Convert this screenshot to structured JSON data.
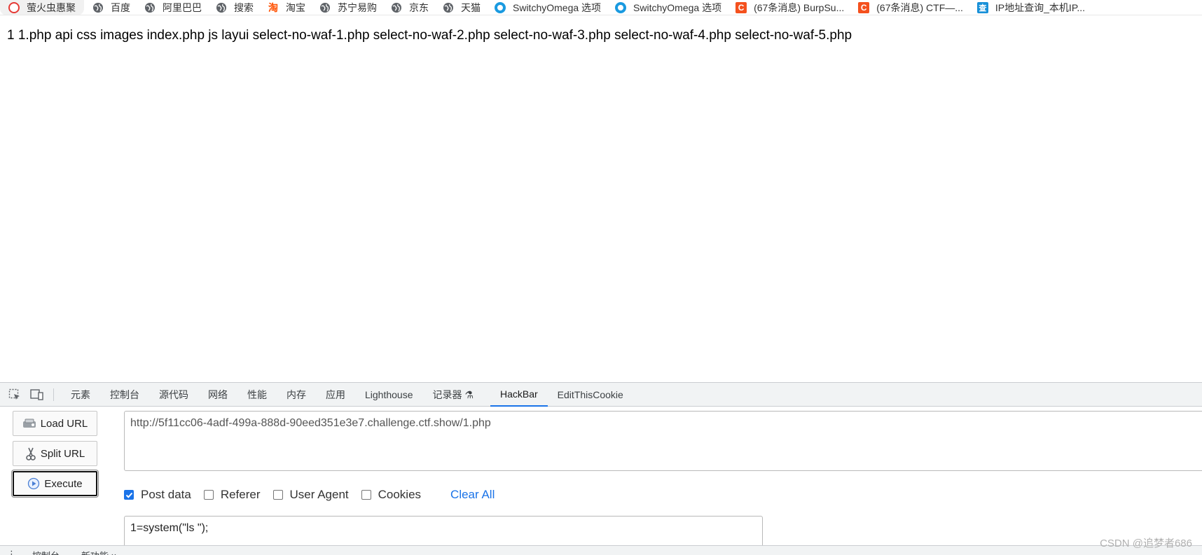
{
  "bookmarks": [
    {
      "label": "萤火虫惠聚",
      "icon": "ring-icon"
    },
    {
      "label": "百度",
      "icon": "globe-icon"
    },
    {
      "label": "阿里巴巴",
      "icon": "globe-icon"
    },
    {
      "label": "搜索",
      "icon": "globe-icon"
    },
    {
      "label": "淘宝",
      "icon": "taobao-icon",
      "glyph": "淘"
    },
    {
      "label": "苏宁易购",
      "icon": "globe-icon"
    },
    {
      "label": "京东",
      "icon": "globe-icon"
    },
    {
      "label": "天猫",
      "icon": "globe-icon"
    },
    {
      "label": "SwitchyOmega 选项",
      "icon": "switchyomega-icon"
    },
    {
      "label": "SwitchyOmega 选项",
      "icon": "switchyomega-icon"
    },
    {
      "label": "(67条消息) BurpSu...",
      "icon": "csdn-icon",
      "glyph": "C"
    },
    {
      "label": "(67条消息) CTF—...",
      "icon": "csdn-icon",
      "glyph": "C"
    },
    {
      "label": "IP地址查询_本机IP...",
      "icon": "ip-query-icon",
      "glyph": "查"
    }
  ],
  "page": {
    "output": "1 1.php api css images index.php js layui select-no-waf-1.php select-no-waf-2.php select-no-waf-3.php select-no-waf-4.php select-no-waf-5.php"
  },
  "devtools": {
    "tabs": [
      "元素",
      "控制台",
      "源代码",
      "网络",
      "性能",
      "内存",
      "应用",
      "Lighthouse",
      "记录器 ⚗",
      "HackBar",
      "EditThisCookie"
    ],
    "active_tab": "HackBar",
    "drawer_tabs": [
      "控制台",
      "新功能 ×"
    ]
  },
  "hackbar": {
    "load_url_label": "Load URL",
    "split_url_label": "Split URL",
    "execute_label": "Execute",
    "url_value": "http://5f11cc06-4adf-499a-888d-90eed351e3e7.challenge.ctf.show/1.php",
    "post_data_label": "Post data",
    "post_data_checked": true,
    "referer_label": "Referer",
    "user_agent_label": "User Agent",
    "cookies_label": "Cookies",
    "clear_all_label": "Clear All",
    "post_body": "1=system(\"ls \");"
  },
  "watermark": "CSDN @追梦者686",
  "colors": {
    "accent": "#1a73e8",
    "csdn": "#f4511e",
    "switchy": "#1a9ae0"
  }
}
